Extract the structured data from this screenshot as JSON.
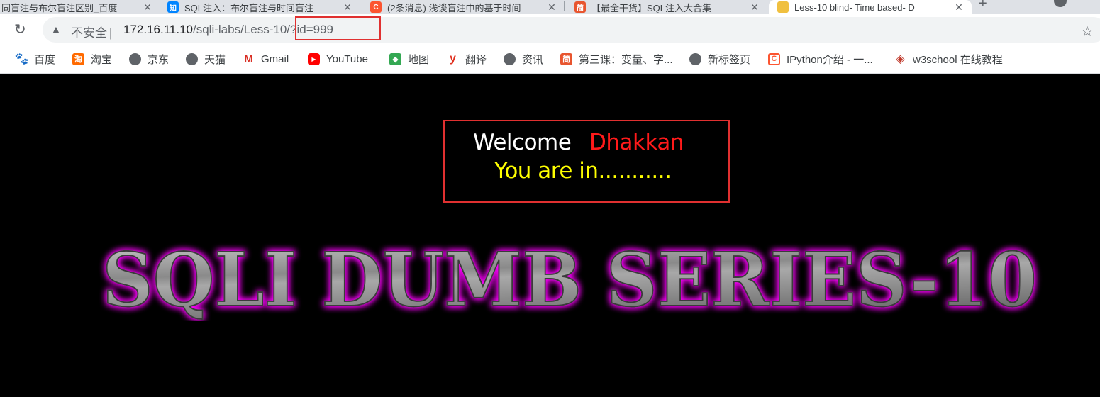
{
  "tabs": [
    {
      "title": "同盲注与布尔盲注区别_百度",
      "favicon": "",
      "color": "#dee1e6"
    },
    {
      "title": "SQL注入：布尔盲注与时间盲注",
      "favicon": "知",
      "color": "#0084ff"
    },
    {
      "title": "(2条消息) 浅谈盲注中的基于时间",
      "favicon": "C",
      "color": "#fc5531"
    },
    {
      "title": "【最全干货】SQL注入大合集",
      "favicon": "简",
      "color": "#e8552f"
    },
    {
      "title": "Less-10 blind- Time based- D",
      "favicon": "",
      "color": "#f0c040"
    }
  ],
  "toolbar": {
    "reload_icon": "reload-icon",
    "security_warning": "不安全",
    "separator": "|",
    "url_host": "172.16.11.10",
    "url_path": "/sqli-labs/Less-10/?id=999",
    "star_icon": "star-icon"
  },
  "bookmarks": [
    {
      "label": "百度",
      "icon": "baidu-paw-icon",
      "glyph": "🐾",
      "cls": "baidu"
    },
    {
      "label": "淘宝",
      "icon": "taobao-icon",
      "glyph": "淘",
      "cls": "taobao"
    },
    {
      "label": "京东",
      "icon": "globe-icon",
      "glyph": "",
      "cls": "globe"
    },
    {
      "label": "天猫",
      "icon": "globe-icon",
      "glyph": "",
      "cls": "globe"
    },
    {
      "label": "Gmail",
      "icon": "gmail-icon",
      "glyph": "M",
      "cls": "gmail"
    },
    {
      "label": "YouTube",
      "icon": "youtube-icon",
      "glyph": "▶",
      "cls": "yt"
    },
    {
      "label": "地图",
      "icon": "maps-icon",
      "glyph": "◆",
      "cls": "map"
    },
    {
      "label": "翻译",
      "icon": "translate-icon",
      "glyph": "y",
      "cls": "fanyi"
    },
    {
      "label": "资讯",
      "icon": "globe-icon",
      "glyph": "",
      "cls": "globe"
    },
    {
      "label": "第三课：变量、字...",
      "icon": "jianshu-icon",
      "glyph": "简",
      "cls": "jian"
    },
    {
      "label": "新标签页",
      "icon": "globe-icon",
      "glyph": "",
      "cls": "globe"
    },
    {
      "label": "IPython介绍 - 一...",
      "icon": "csdn-icon",
      "glyph": "C",
      "cls": "csdn"
    },
    {
      "label": "w3school 在线教程",
      "icon": "w3school-icon",
      "glyph": "◈",
      "cls": "w3"
    }
  ],
  "page": {
    "welcome_text": "Welcome",
    "user_name": "Dhakkan",
    "status_text": "You are in...........",
    "series_title": "SQLI DUMB SERIES-10"
  },
  "colors": {
    "background": "#000000",
    "welcome": "#ffffff",
    "user_name": "#ff1a1a",
    "status": "#ffff00",
    "highlight_border": "#e03030",
    "title_glow": "#ff00ff",
    "title_fill": "#9a9a9a"
  }
}
